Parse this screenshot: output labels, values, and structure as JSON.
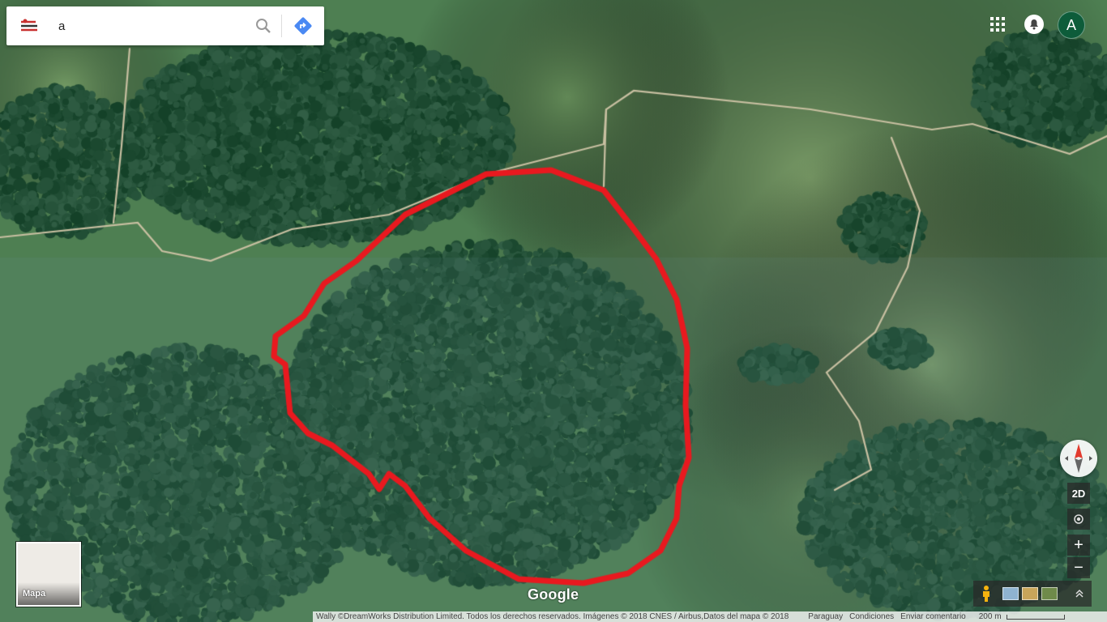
{
  "search": {
    "query": "a"
  },
  "account": {
    "avatar_letter": "A"
  },
  "map_type": {
    "label": "Mapa"
  },
  "brand": {
    "logo_text": "Google"
  },
  "controls": {
    "view_mode_label": "2D",
    "zoom_in_label": "+",
    "zoom_out_label": "−"
  },
  "footer": {
    "attribution": "Wally ©DreamWorks Distribution Limited. Todos los derechos reservados. Imágenes © 2018 CNES / Airbus,Datos del mapa © 2018",
    "country": "Paraguay",
    "terms": "Condiciones",
    "feedback": "Enviar comentario",
    "scale": "200 m"
  },
  "colors": {
    "route": "#e8191f",
    "avatar_bg": "#0d5c3a",
    "directions_blue": "#4a89f3"
  },
  "icons": [
    "wally-menu-icon",
    "search-icon",
    "directions-icon",
    "apps-grid-icon",
    "notifications-icon",
    "compass-icon",
    "my-location-icon",
    "pegman-icon",
    "expand-icon"
  ]
}
